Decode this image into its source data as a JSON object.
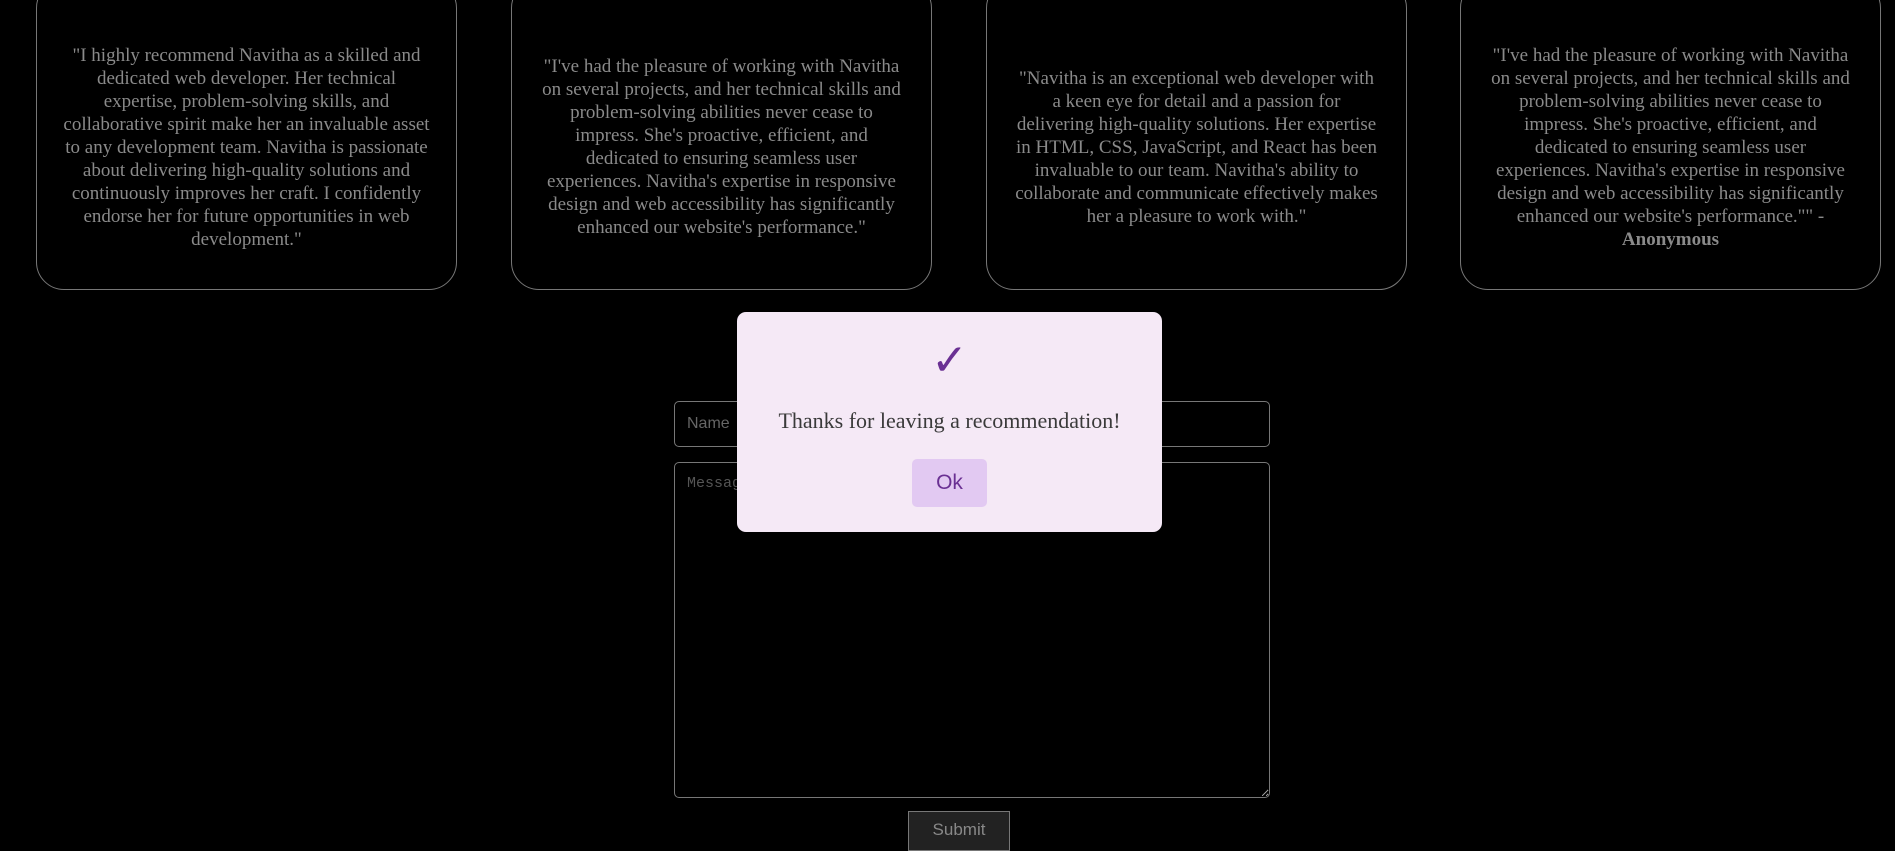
{
  "testimonials": [
    {
      "text": "\"I highly recommend Navitha as a skilled and dedicated web developer. Her technical expertise, problem-solving skills, and collaborative spirit make her an invaluable asset to any development team. Navitha is passionate about delivering high-quality solutions and continuously improves her craft. I confidently endorse her for future opportunities in web development.\"",
      "author": ""
    },
    {
      "text": "\"I've had the pleasure of working with Navitha on several projects, and her technical skills and problem-solving abilities never cease to impress. She's proactive, efficient, and dedicated to ensuring seamless user experiences. Navitha's expertise in responsive design and web accessibility has significantly enhanced our website's performance.\"",
      "author": ""
    },
    {
      "text": "\"Navitha is an exceptional web developer with a keen eye for detail and a passion for delivering high-quality solutions. Her expertise in HTML, CSS, JavaScript, and React has been invaluable to our team. Navitha's ability to collaborate and communicate effectively makes her a pleasure to work with.\"",
      "author": ""
    },
    {
      "text": "\"I've had the pleasure of working with Navitha on several projects, and her technical skills and problem-solving abilities never cease to impress. She's proactive, efficient, and dedicated to ensuring seamless user experiences. Navitha's expertise in responsive design and web accessibility has significantly enhanced our website's performance.\"\" -",
      "author": "Anonymous"
    }
  ],
  "form": {
    "name_placeholder": "Name",
    "message_placeholder": "Message",
    "submit_label": "Submit"
  },
  "modal": {
    "icon": "checkmark-icon",
    "check_glyph": "✓",
    "message": "Thanks for leaving a recommendation!",
    "ok_label": "Ok",
    "accent": "#6a3093"
  }
}
